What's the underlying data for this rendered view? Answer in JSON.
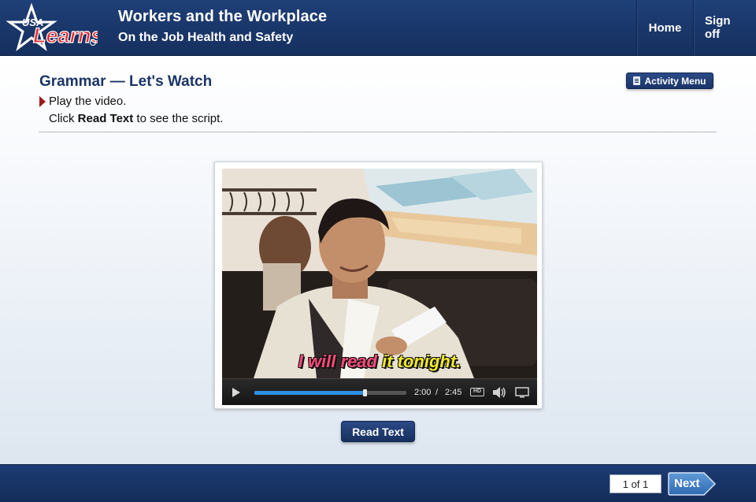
{
  "header": {
    "logo_text_top": "USA",
    "logo_text_main": "Learns",
    "course_title": "Workers and the Workplace",
    "course_subtitle": "On the Job Health and Safety",
    "nav": {
      "home": "Home",
      "sign_off": "Sign off"
    }
  },
  "main": {
    "page_title": "Grammar — Let's Watch",
    "instruction_1": "Play the video.",
    "instruction_2_prefix": "Click ",
    "instruction_2_bold": "Read Text",
    "instruction_2_suffix": " to see the script.",
    "activity_menu_label": "Activity Menu",
    "video": {
      "caption_highlight": "I will read",
      "caption_rest": " it tonight.",
      "time_current": "2:00",
      "time_separator": "/",
      "time_total": "2:45",
      "hd_label": "HD",
      "progress": 0.727
    },
    "read_text_label": "Read Text"
  },
  "footer": {
    "page_counter": "1 of 1",
    "next_label": "Next"
  },
  "colors": {
    "header_bg": "#1a3668",
    "accent_red": "#9b1c1c",
    "seek_blue": "#2e8fe0",
    "caption_yellow": "#f2ea2a",
    "caption_pink": "#ff4a7a"
  },
  "icons": [
    "usa-learns-logo",
    "play-icon",
    "hd-icon",
    "volume-icon",
    "fullscreen-icon",
    "book-icon",
    "arrow-right-icon"
  ]
}
